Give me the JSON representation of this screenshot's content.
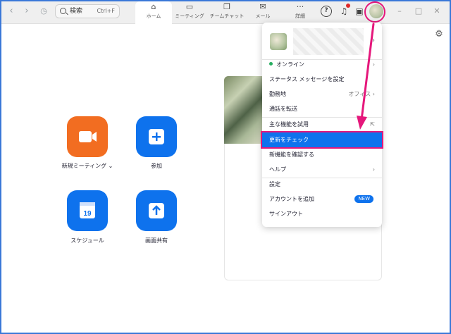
{
  "toolbar": {
    "search_placeholder": "検索",
    "search_shortcut": "Ctrl+F",
    "tabs": [
      {
        "label": "ホーム",
        "icon": "home-icon"
      },
      {
        "label": "ミーティング",
        "icon": "video-icon"
      },
      {
        "label": "チームチャット",
        "icon": "chat-icon"
      },
      {
        "label": "メール",
        "icon": "mail-icon"
      },
      {
        "label": "詳細",
        "icon": "more-icon"
      }
    ]
  },
  "actions": [
    {
      "label": "新規ミーティング",
      "icon": "camera-icon",
      "color": "#f26d21"
    },
    {
      "label": "参加",
      "icon": "plus-icon",
      "color": "#0e72ed"
    },
    {
      "label": "スケジュール",
      "icon": "calendar-icon",
      "color": "#0e72ed",
      "day": "19"
    },
    {
      "label": "画面共有",
      "icon": "share-up-icon",
      "color": "#0e72ed"
    }
  ],
  "menu": {
    "items": [
      {
        "label": "オンライン"
      },
      {
        "label": "ステータス メッセージを設定"
      },
      {
        "label": "勤務地",
        "value": "オフィス"
      },
      {
        "label": "通話を転送"
      },
      {
        "label": "主な機能を試用"
      },
      {
        "label": "更新をチェック"
      },
      {
        "label": "新機能を確認する"
      },
      {
        "label": "ヘルプ"
      },
      {
        "label": "設定"
      },
      {
        "label": "アカウントを追加",
        "badge": "NEW"
      },
      {
        "label": "サインアウト"
      }
    ]
  },
  "colors": {
    "accent": "#0e72ed",
    "highlight_border": "#e5177b",
    "orange": "#f26d21"
  }
}
